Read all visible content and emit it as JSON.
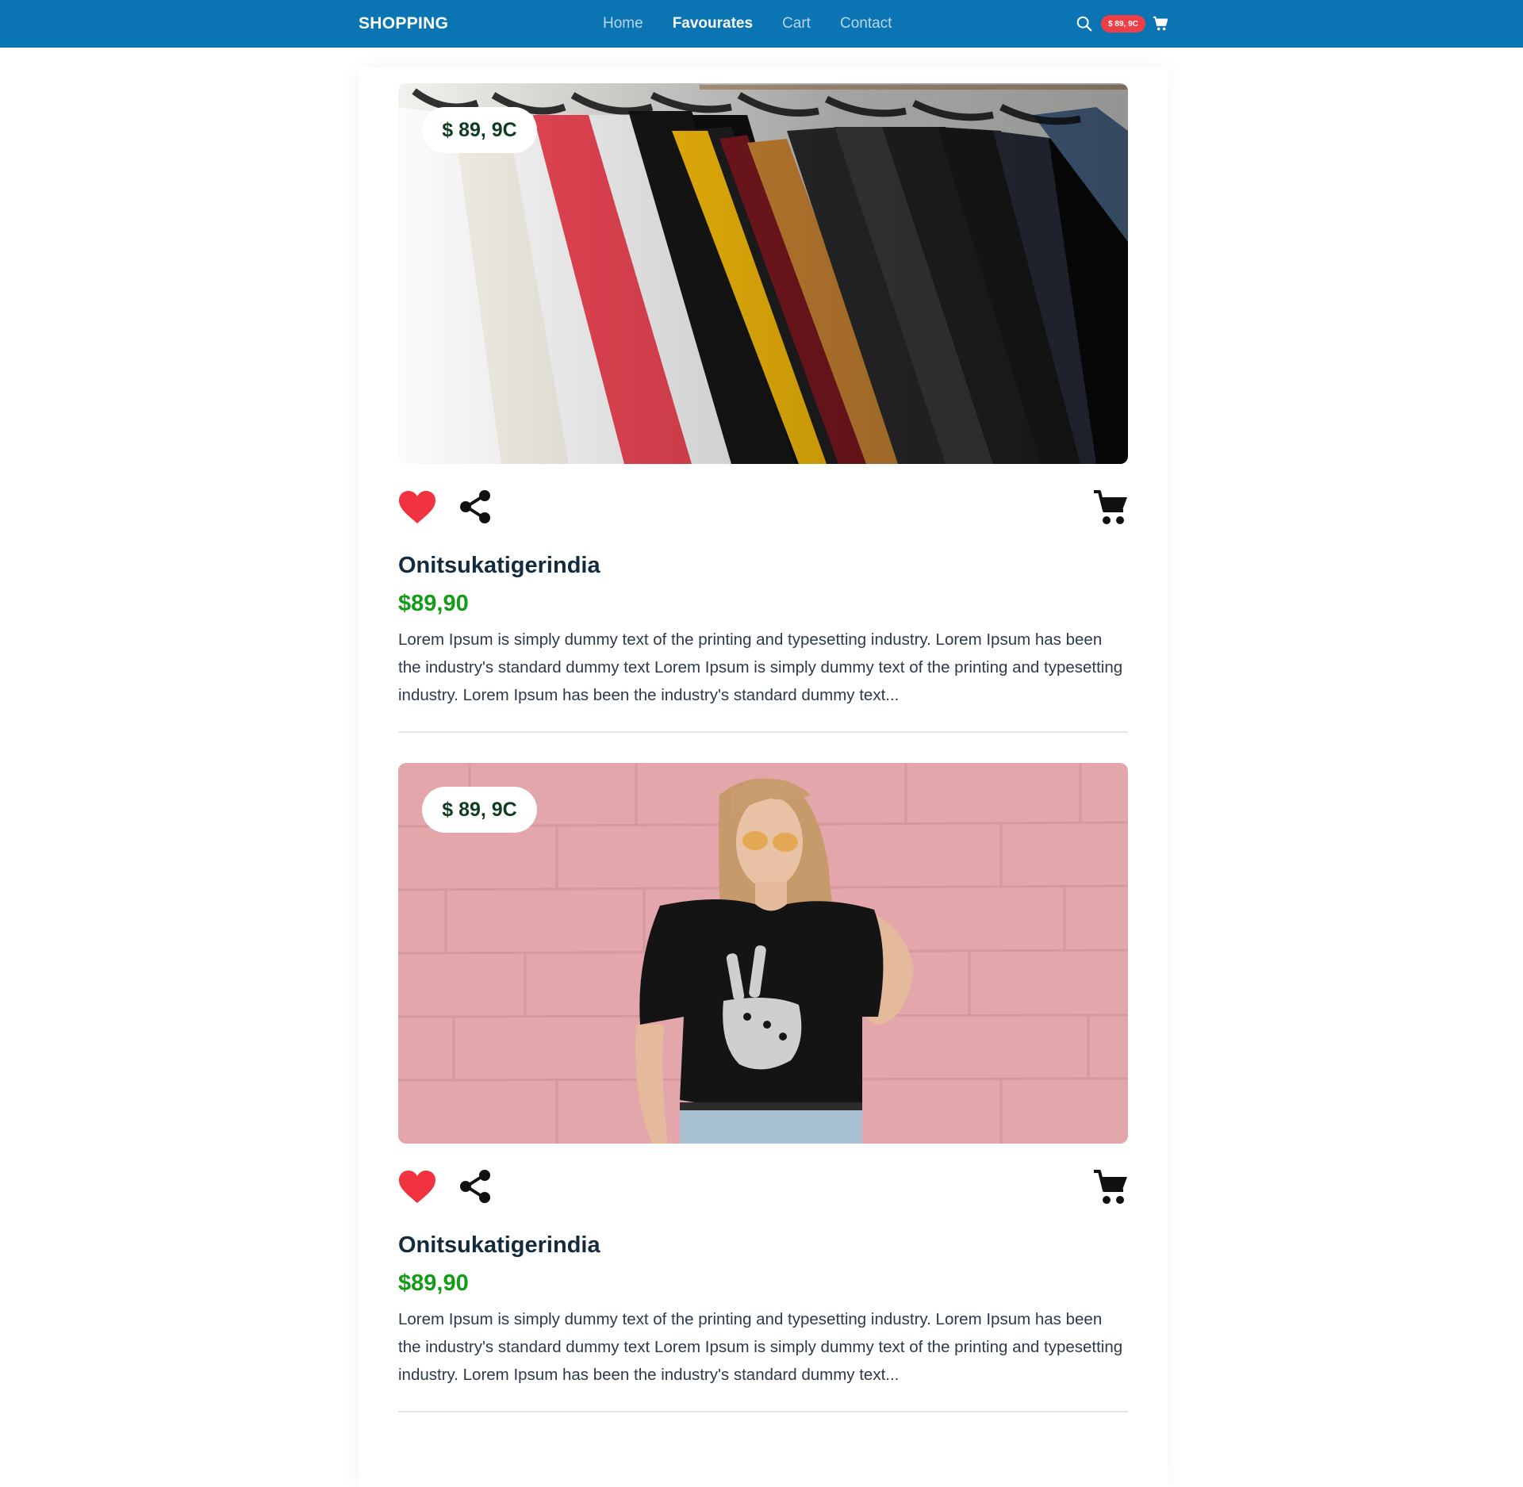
{
  "nav": {
    "brand": "SHOPPING",
    "links": [
      "Home",
      "Favourates",
      "Cart",
      "Contact"
    ],
    "active_link": "Favourates",
    "cart_badge": "$ 89, 9C",
    "icons": {
      "search": "search-icon",
      "cart": "cart-icon"
    }
  },
  "products": [
    {
      "image": "rack of colorful shirts on hangers",
      "price_tag": "$ 89, 9C",
      "title": "Onitsukatigerindia",
      "price": "$89,90",
      "description": "Lorem Ipsum is simply dummy text of the printing and typesetting industry. Lorem Ipsum has been the industry's standard dummy text Lorem Ipsum is simply dummy text of the printing and typesetting industry. Lorem Ipsum has been the industry's standard dummy text...",
      "favorited": true
    },
    {
      "image": "woman in black peace-sign t-shirt against pink brick wall",
      "price_tag": "$ 89, 9C",
      "title": "Onitsukatigerindia",
      "price": "$89,90",
      "description": "Lorem Ipsum is simply dummy text of the printing and typesetting industry. Lorem Ipsum has been the industry's standard dummy text Lorem Ipsum is simply dummy text of the printing and typesetting industry. Lorem Ipsum has been the industry's standard dummy text...",
      "favorited": true
    }
  ],
  "colors": {
    "nav_background": "#0b74b2",
    "badge": "#ef3e45",
    "heart": "#f0333e",
    "price_green": "#129c17",
    "title": "#132b3d"
  }
}
